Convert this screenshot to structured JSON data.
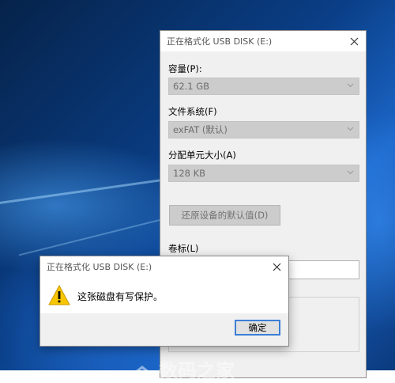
{
  "format_window": {
    "title": "正在格式化 USB DISK (E:)",
    "capacity_label": "容量(P):",
    "capacity_value": "62.1 GB",
    "filesystem_label": "文件系统(F)",
    "filesystem_value": "exFAT (默认)",
    "allocation_label": "分配单元大小(A)",
    "allocation_value": "128 KB",
    "restore_button": "还原设备的默认值(D)",
    "volume_label": "卷标(L)"
  },
  "message_box": {
    "title": "正在格式化 USB DISK (E:)",
    "message": "这张磁盘有写保护。",
    "icon": "warning-icon",
    "ok_button": "确定"
  },
  "watermark": {
    "text": "数码之家"
  },
  "colors": {
    "desktop_blue": "#0a3e86",
    "window_bg": "#f0f0f0",
    "focus_border": "#3c7fd6",
    "warning_yellow": "#f7c600"
  }
}
